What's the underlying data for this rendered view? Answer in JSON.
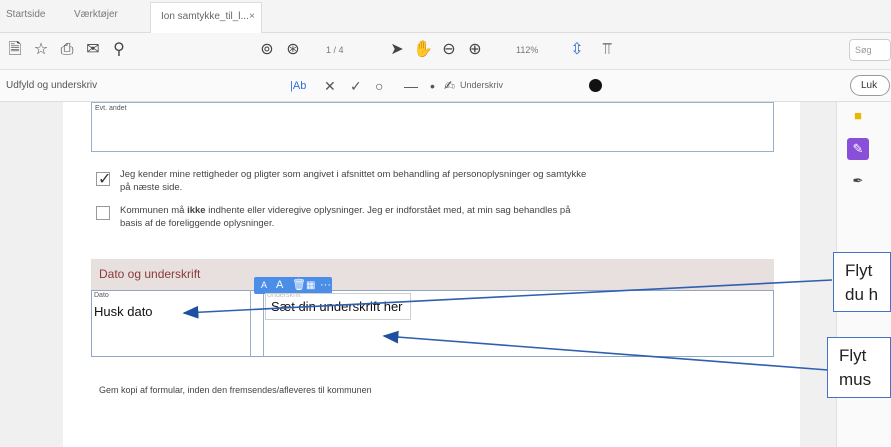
{
  "tabs": [
    {
      "label": "Startside"
    },
    {
      "label": "Værktøjer"
    },
    {
      "label": "Ion samtykke_til_l...",
      "close": "×"
    }
  ],
  "toolbar": {
    "page_indicator": "1 / 4",
    "zoom": "112%",
    "search_placeholder": "Søg"
  },
  "signbar": {
    "title": "Udfyld og underskriv",
    "text_tool": "|Ab",
    "sign_label": "Underskriv",
    "close_label": "Luk",
    "ink_color": "#000000"
  },
  "form": {
    "other_field_label": "Evt. andet",
    "consent_text_1": "Jeg kender mine rettigheder og pligter som angivet i afsnittet om behandling af personoplysninger og samtykke",
    "consent_text_2": "på næste side.",
    "municipality_text_pre": "Kommunen må ",
    "municipality_text_bold": "ikke",
    "municipality_text_post": " indhente eller videregive oplysninger. Jeg er indforstået med, at min sag behandles på",
    "municipality_text_2": "basis af de foreliggende oplysninger.",
    "section_title": "Dato og underskrift",
    "date_label": "Dato",
    "date_value": "Husk dato",
    "signature_label": "Underskrift",
    "signature_value": "Sæt din underskrift her",
    "footer_text": "Gem kopi af formular, inden den fremsendes/afleveres til kommunen"
  },
  "callouts": [
    {
      "text": "Flyt du h"
    },
    {
      "text": "Flyt mus"
    }
  ],
  "colors": {
    "accent": "#4a8ee8",
    "callout_border": "#4472c4",
    "section_title": "#8a3b3b"
  }
}
